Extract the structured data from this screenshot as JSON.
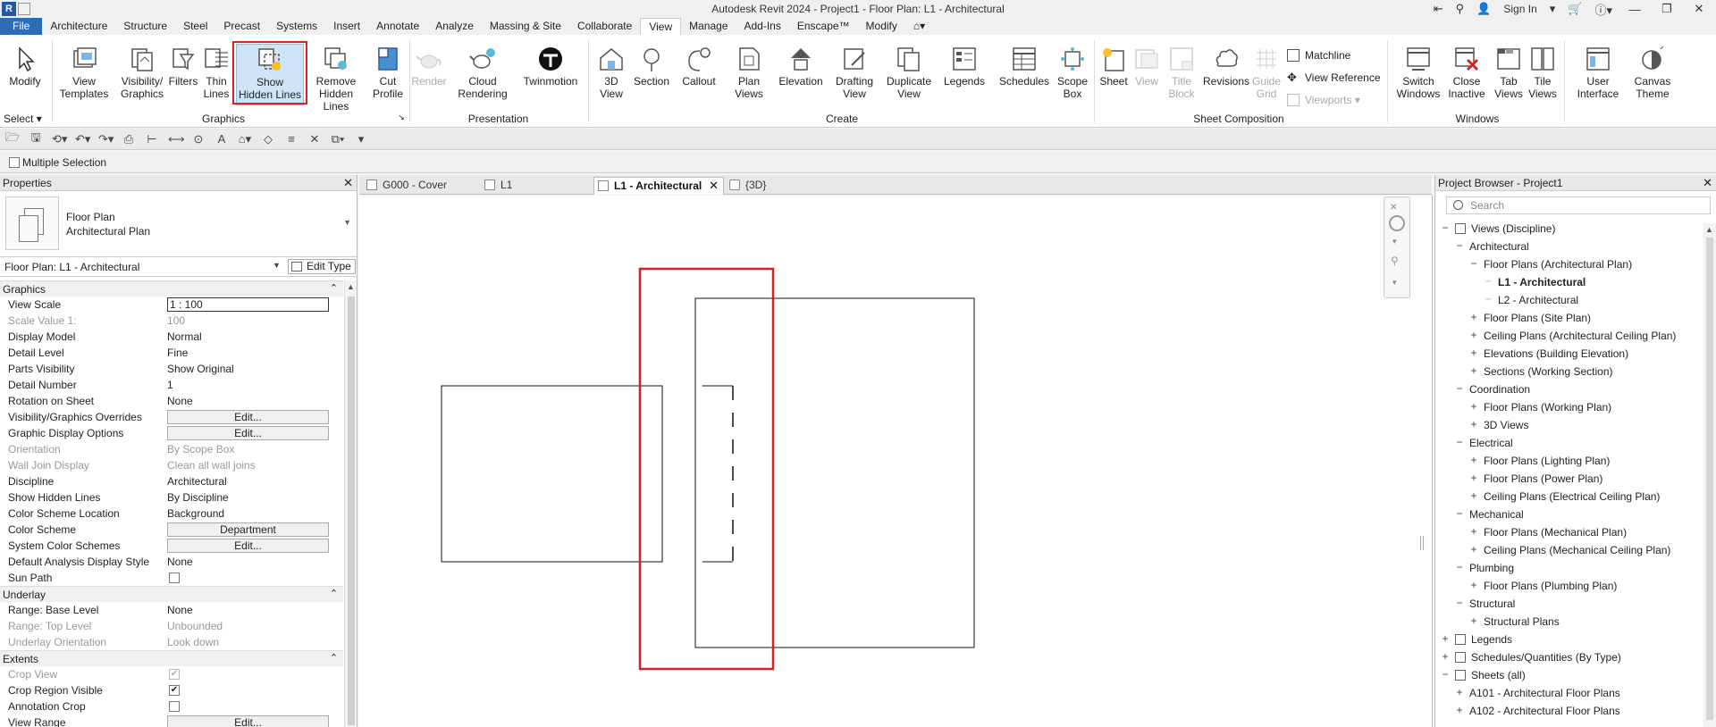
{
  "title_bar": {
    "app_icon": "R",
    "title": "Autodesk Revit 2024 - Project1 - Floor Plan: L1 - Architectural",
    "sign_in": "Sign In",
    "icons": [
      "back-icon",
      "binoculars-icon",
      "user-icon",
      "cart-icon",
      "help-icon",
      "minimize-icon",
      "restore-icon",
      "close-icon"
    ]
  },
  "menu_tabs": [
    "File",
    "Architecture",
    "Structure",
    "Steel",
    "Precast",
    "Systems",
    "Insert",
    "Annotate",
    "Analyze",
    "Massing & Site",
    "Collaborate",
    "View",
    "Manage",
    "Add-Ins",
    "Enscape™",
    "Modify"
  ],
  "active_tab": "View",
  "ribbon": {
    "modify": "Modify",
    "select": "Select",
    "buttons": {
      "view_templates": "View\nTemplates",
      "visibility_graphics": "Visibility/\nGraphics",
      "filters": "Filters",
      "thin_lines": "Thin\nLines",
      "show_hidden_lines": "Show\nHidden Lines",
      "remove_hidden_lines": "Remove\nHidden Lines",
      "cut_profile": "Cut\nProfile",
      "render": "Render",
      "cloud_rendering": "Cloud\nRendering",
      "twinmotion": "Twinmotion",
      "three_d_view": "3D\nView",
      "section": "Section",
      "callout": "Callout",
      "plan_views": "Plan\nViews",
      "elevation": "Elevation",
      "drafting_view": "Drafting\nView",
      "duplicate_view": "Duplicate\nView",
      "legends": "Legends",
      "schedules": "Schedules",
      "scope_box": "Scope\nBox",
      "sheet": "Sheet",
      "view": "View",
      "title_block": "Title\nBlock",
      "revisions": "Revisions",
      "guide_grid": "Guide\nGrid",
      "matchline": "Matchline",
      "view_reference": "View  Reference",
      "viewports": "Viewports",
      "switch_windows": "Switch\nWindows",
      "close_inactive": "Close\nInactive",
      "tab_views": "Tab\nViews",
      "tile_views": "Tile\nViews",
      "user_interface": "User\nInterface",
      "canvas_theme": "Canvas\nTheme"
    },
    "panels": {
      "graphics": "Graphics",
      "presentation": "Presentation",
      "create": "Create",
      "sheet_composition": "Sheet Composition",
      "windows": "Windows"
    }
  },
  "options_bar": {
    "multiple_selection": "Multiple Selection"
  },
  "properties": {
    "title": "Properties",
    "type_line1": "Floor Plan",
    "type_line2": "Architectural Plan",
    "instance": "Floor Plan: L1 - Architectural",
    "edit_type": "Edit Type",
    "groups": {
      "graphics": "Graphics",
      "underlay": "Underlay",
      "extents": "Extents"
    },
    "graphics_rows": [
      {
        "k": "View Scale",
        "v": "1 : 100"
      },
      {
        "k": "Scale Value    1:",
        "v": "100"
      },
      {
        "k": "Display Model",
        "v": "Normal"
      },
      {
        "k": "Detail Level",
        "v": "Fine"
      },
      {
        "k": "Parts Visibility",
        "v": "Show Original"
      },
      {
        "k": "Detail Number",
        "v": "1"
      },
      {
        "k": "Rotation on Sheet",
        "v": "None"
      },
      {
        "k": "Visibility/Graphics Overrides",
        "v": "Edit..."
      },
      {
        "k": "Graphic Display Options",
        "v": "Edit..."
      },
      {
        "k": "Orientation",
        "v": "By Scope Box"
      },
      {
        "k": "Wall Join Display",
        "v": "Clean all wall joins"
      },
      {
        "k": "Discipline",
        "v": "Architectural"
      },
      {
        "k": "Show Hidden Lines",
        "v": "By Discipline"
      },
      {
        "k": "Color Scheme Location",
        "v": "Background"
      },
      {
        "k": "Color Scheme",
        "v": "Department"
      },
      {
        "k": "System Color Schemes",
        "v": "Edit..."
      },
      {
        "k": "Default Analysis Display Style",
        "v": "None"
      },
      {
        "k": "Sun Path",
        "v": ""
      }
    ],
    "underlay_rows": [
      {
        "k": "Range: Base Level",
        "v": "None"
      },
      {
        "k": "Range: Top Level",
        "v": "Unbounded"
      },
      {
        "k": "Underlay Orientation",
        "v": "Look down"
      }
    ],
    "extents_rows": [
      {
        "k": "Crop View",
        "v": ""
      },
      {
        "k": "Crop Region Visible",
        "v": ""
      },
      {
        "k": "Annotation Crop",
        "v": ""
      },
      {
        "k": "View Range",
        "v": "Edit..."
      }
    ]
  },
  "view_tabs": [
    {
      "label": "G000 - Cover"
    },
    {
      "label": "L1"
    },
    {
      "label": "L1 - Architectural"
    },
    {
      "label": "{3D}"
    }
  ],
  "project_browser": {
    "title": "Project Browser - Project1",
    "search_placeholder": "Search",
    "nodes": [
      {
        "text": "Views (Discipline)",
        "toggle": "−",
        "level": 0,
        "icon": true
      },
      {
        "text": "Architectural",
        "toggle": "−",
        "level": 1
      },
      {
        "text": "Floor Plans (Architectural Plan)",
        "toggle": "−",
        "level": 2
      },
      {
        "text": "L1 - Architectural",
        "toggle": "",
        "level": 3,
        "bold": true
      },
      {
        "text": "L2 - Architectural",
        "toggle": "",
        "level": 3
      },
      {
        "text": "Floor Plans (Site Plan)",
        "toggle": "+",
        "level": 2
      },
      {
        "text": "Ceiling Plans (Architectural Ceiling Plan)",
        "toggle": "+",
        "level": 2
      },
      {
        "text": "Elevations (Building Elevation)",
        "toggle": "+",
        "level": 2
      },
      {
        "text": "Sections (Working Section)",
        "toggle": "+",
        "level": 2
      },
      {
        "text": "Coordination",
        "toggle": "−",
        "level": 1
      },
      {
        "text": "Floor Plans (Working Plan)",
        "toggle": "+",
        "level": 2
      },
      {
        "text": "3D Views",
        "toggle": "+",
        "level": 2
      },
      {
        "text": "Electrical",
        "toggle": "−",
        "level": 1
      },
      {
        "text": "Floor Plans (Lighting Plan)",
        "toggle": "+",
        "level": 2
      },
      {
        "text": "Floor Plans (Power Plan)",
        "toggle": "+",
        "level": 2
      },
      {
        "text": "Ceiling Plans (Electrical Ceiling Plan)",
        "toggle": "+",
        "level": 2
      },
      {
        "text": "Mechanical",
        "toggle": "−",
        "level": 1
      },
      {
        "text": "Floor Plans (Mechanical Plan)",
        "toggle": "+",
        "level": 2
      },
      {
        "text": "Ceiling Plans (Mechanical Ceiling Plan)",
        "toggle": "+",
        "level": 2
      },
      {
        "text": "Plumbing",
        "toggle": "−",
        "level": 1
      },
      {
        "text": "Floor Plans (Plumbing Plan)",
        "toggle": "+",
        "level": 2
      },
      {
        "text": "Structural",
        "toggle": "−",
        "level": 1
      },
      {
        "text": "Structural Plans",
        "toggle": "+",
        "level": 2
      },
      {
        "text": "Legends",
        "toggle": "+",
        "level": 0,
        "icon": true
      },
      {
        "text": "Schedules/Quantities (By Type)",
        "toggle": "+",
        "level": 0,
        "icon": true
      },
      {
        "text": "Sheets (all)",
        "toggle": "−",
        "level": 0,
        "icon": true
      },
      {
        "text": "A101 - Architectural Floor Plans",
        "toggle": "+",
        "level": 1
      },
      {
        "text": "A102 - Architectural Floor Plans",
        "toggle": "+",
        "level": 1
      }
    ]
  },
  "colors": {
    "file_tab": "#2d6db5",
    "highlight": "#d22222",
    "wall_lines": "#111111"
  }
}
